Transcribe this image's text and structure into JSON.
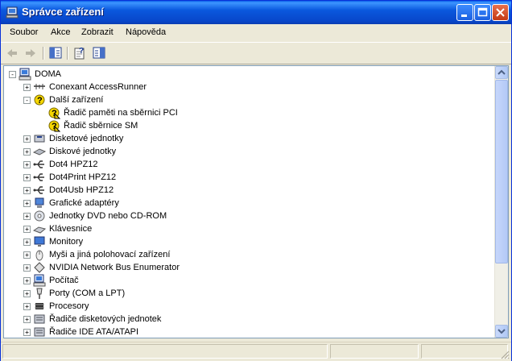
{
  "window": {
    "title": "Správce zařízení"
  },
  "menu": {
    "items": [
      "Soubor",
      "Akce",
      "Zobrazit",
      "Nápověda"
    ]
  },
  "tree": {
    "root": "DOMA",
    "items": [
      {
        "label": "Conexant AccessRunner",
        "icon": "modem-icon",
        "expanded": false
      },
      {
        "label": "Další zařízení",
        "icon": "unknown-device-icon",
        "expanded": true,
        "children": [
          "Řadič paměti na sběrnici PCI",
          "Řadič sběrnice SM"
        ]
      },
      {
        "label": "Disketové jednotky",
        "icon": "floppy-drive-icon",
        "expanded": false
      },
      {
        "label": "Diskové jednotky",
        "icon": "disk-drive-icon",
        "expanded": false
      },
      {
        "label": "Dot4 HPZ12",
        "icon": "usb-icon",
        "expanded": false
      },
      {
        "label": "Dot4Print HPZ12",
        "icon": "usb-icon",
        "expanded": false
      },
      {
        "label": "Dot4Usb HPZ12",
        "icon": "usb-icon",
        "expanded": false
      },
      {
        "label": "Grafické adaptéry",
        "icon": "display-adapter-icon",
        "expanded": false
      },
      {
        "label": "Jednotky DVD nebo CD-ROM",
        "icon": "cdrom-icon",
        "expanded": false
      },
      {
        "label": "Klávesnice",
        "icon": "keyboard-icon",
        "expanded": false
      },
      {
        "label": "Monitory",
        "icon": "monitor-icon",
        "expanded": false
      },
      {
        "label": "Myši a jiná polohovací zařízení",
        "icon": "mouse-icon",
        "expanded": false
      },
      {
        "label": "NVIDIA Network Bus Enumerator",
        "icon": "network-bus-icon",
        "expanded": false
      },
      {
        "label": "Počítač",
        "icon": "computer-icon",
        "expanded": false
      },
      {
        "label": "Porty (COM a LPT)",
        "icon": "port-icon",
        "expanded": false
      },
      {
        "label": "Procesory",
        "icon": "processor-icon",
        "expanded": false
      },
      {
        "label": "Řadiče disketových jednotek",
        "icon": "floppy-controller-icon",
        "expanded": false
      },
      {
        "label": "Řadiče IDE ATA/ATAPI",
        "icon": "ide-controller-icon",
        "expanded": false
      }
    ]
  },
  "colors": {
    "titlebar": "#0a58de",
    "warning": "#f5d600"
  }
}
